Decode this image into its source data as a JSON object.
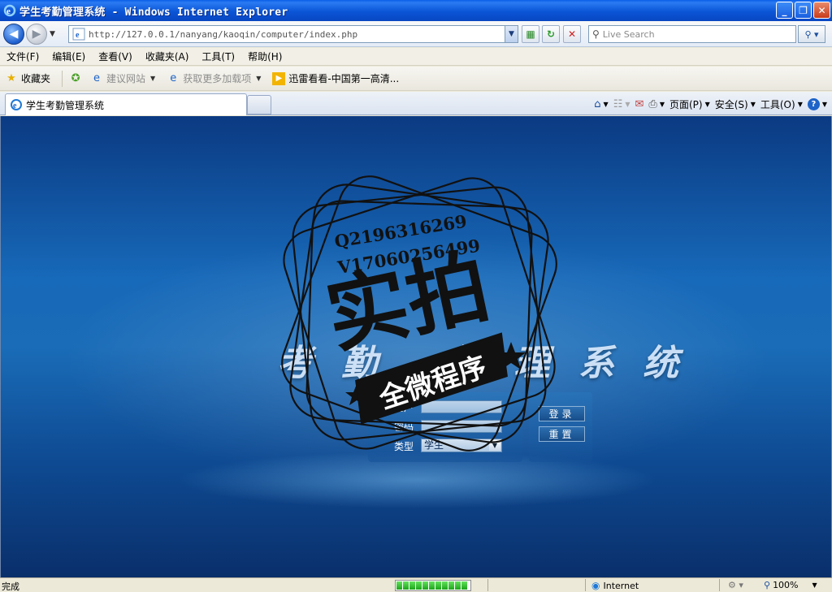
{
  "window": {
    "title": "学生考勤管理系统 - Windows Internet Explorer",
    "minimize_glyph": "_",
    "restore_glyph": "❐",
    "close_glyph": "✕"
  },
  "address": {
    "url": "http://127.0.0.1/nanyang/kaoqin/computer/index.php"
  },
  "search": {
    "placeholder": "Live Search"
  },
  "menu": {
    "items": [
      "文件(F)",
      "编辑(E)",
      "查看(V)",
      "收藏夹(A)",
      "工具(T)",
      "帮助(H)"
    ]
  },
  "favorites": {
    "label": "收藏夹",
    "suggested_sites": "建议网站",
    "get_addons": "获取更多加载项",
    "xunlei": "迅雷看看-中国第一高清..."
  },
  "tab": {
    "title": "学生考勤管理系统"
  },
  "command_bar": {
    "page": "页面(P)",
    "safety": "安全(S)",
    "tools": "工具(O)"
  },
  "page": {
    "system_title": "考 勤 - 管 理 系 统",
    "user_label": "用户",
    "password_label": "密码",
    "type_label": "类型",
    "user_value": "",
    "password_value": "",
    "type_value": "学生",
    "login_button": "登录",
    "reset_button": "重置"
  },
  "watermark": {
    "qq": "Q2196316269",
    "wechat": "V17060256499",
    "big_text": "实拍",
    "ribbon_text": "全微程序"
  },
  "status": {
    "text": "完成",
    "zone": "Internet",
    "zoom": "100%",
    "progress": 1.0
  },
  "colors": {
    "titlebar": "#0a55d6",
    "content_bg": "#1769b9",
    "progress": "#1da41a"
  }
}
